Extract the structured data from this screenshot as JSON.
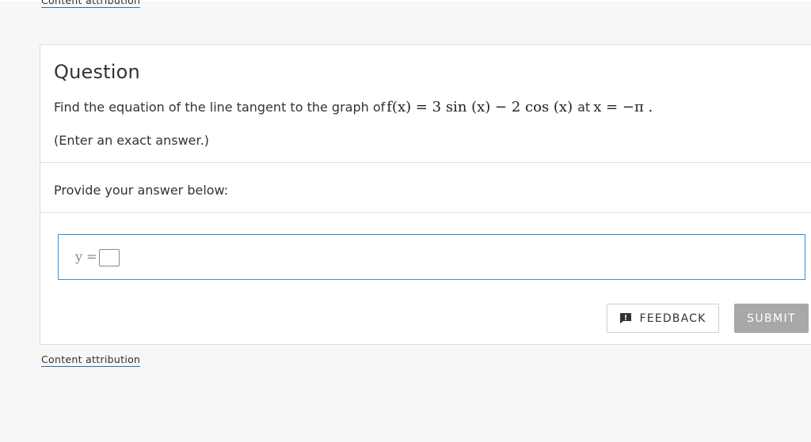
{
  "attribution": {
    "top_label": "Content attribution",
    "bottom_label": "Content attribution"
  },
  "question": {
    "title": "Question",
    "text_prefix": "Find the equation of the line tangent to the graph of",
    "function_expr": "f(x) = 3 sin (x) − 2 cos (x)",
    "text_middle": "at",
    "point_expr": "x = −π .",
    "hint": "(Enter an exact answer.)"
  },
  "answer": {
    "prompt": "Provide your answer below:",
    "lhs_label": "y =",
    "value": ""
  },
  "actions": {
    "feedback_label": "FEEDBACK",
    "feedback_icon": "feedback-icon",
    "submit_label": "SUBMIT"
  },
  "colors": {
    "page_bg": "#f7f7f7",
    "card_border": "#dedede",
    "input_border_active": "#3b8fd0",
    "submit_disabled_bg": "#a8a8a8",
    "link_underline": "#2a6fb0"
  }
}
